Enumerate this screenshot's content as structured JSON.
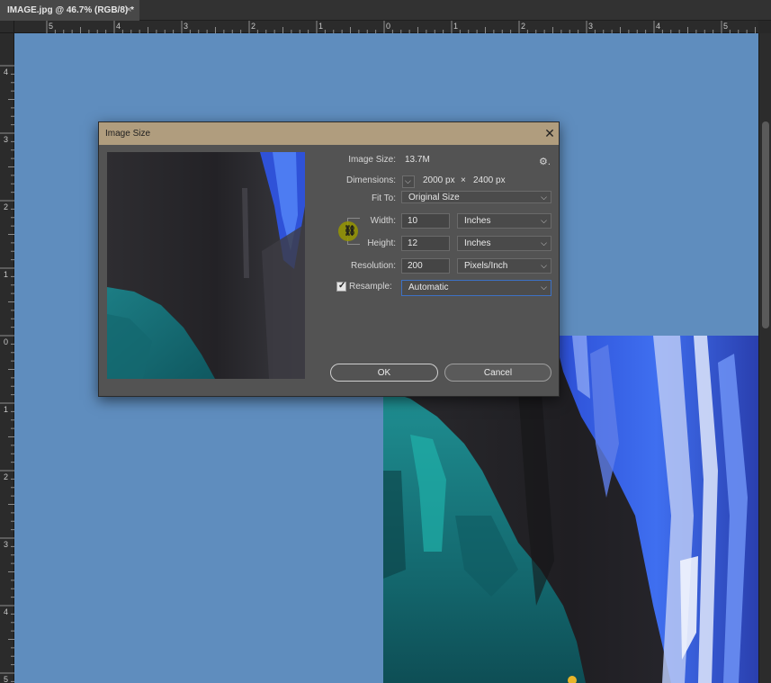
{
  "document_tab": {
    "title": "IMAGE.jpg @ 46.7% (RGB/8) *",
    "close_glyph": "×"
  },
  "ruler": {
    "horizontal_labels": [
      "5",
      "4",
      "3",
      "2",
      "1",
      "0",
      "1",
      "2",
      "3",
      "4",
      "5"
    ],
    "vertical_labels": [
      "4",
      "3",
      "2",
      "1",
      "0",
      "1",
      "2",
      "3",
      "4",
      "5"
    ]
  },
  "dialog": {
    "title": "Image Size",
    "close_glyph": "✕",
    "image_size": {
      "label": "Image Size:",
      "value": "13.7M"
    },
    "settings_icon": "gear-icon",
    "dimensions": {
      "label": "Dimensions:",
      "width": "2000 px",
      "times": "×",
      "height": "2400 px"
    },
    "fit_to": {
      "label": "Fit To:",
      "value": "Original Size"
    },
    "width": {
      "label": "Width:",
      "value": "10",
      "unit": "Inches"
    },
    "height": {
      "label": "Height:",
      "value": "12",
      "unit": "Inches"
    },
    "resolution": {
      "label": "Resolution:",
      "value": "200",
      "unit": "Pixels/Inch"
    },
    "resample": {
      "label": "Resample:",
      "checked": true,
      "value": "Automatic"
    },
    "ok_label": "OK",
    "cancel_label": "Cancel"
  },
  "colors": {
    "canvas_background": "#5f8dbe",
    "dialog_titlebar": "#b09d7e",
    "dialog_body": "#535353",
    "focus_border": "#3d71c4",
    "link_highlight": "#969600"
  }
}
